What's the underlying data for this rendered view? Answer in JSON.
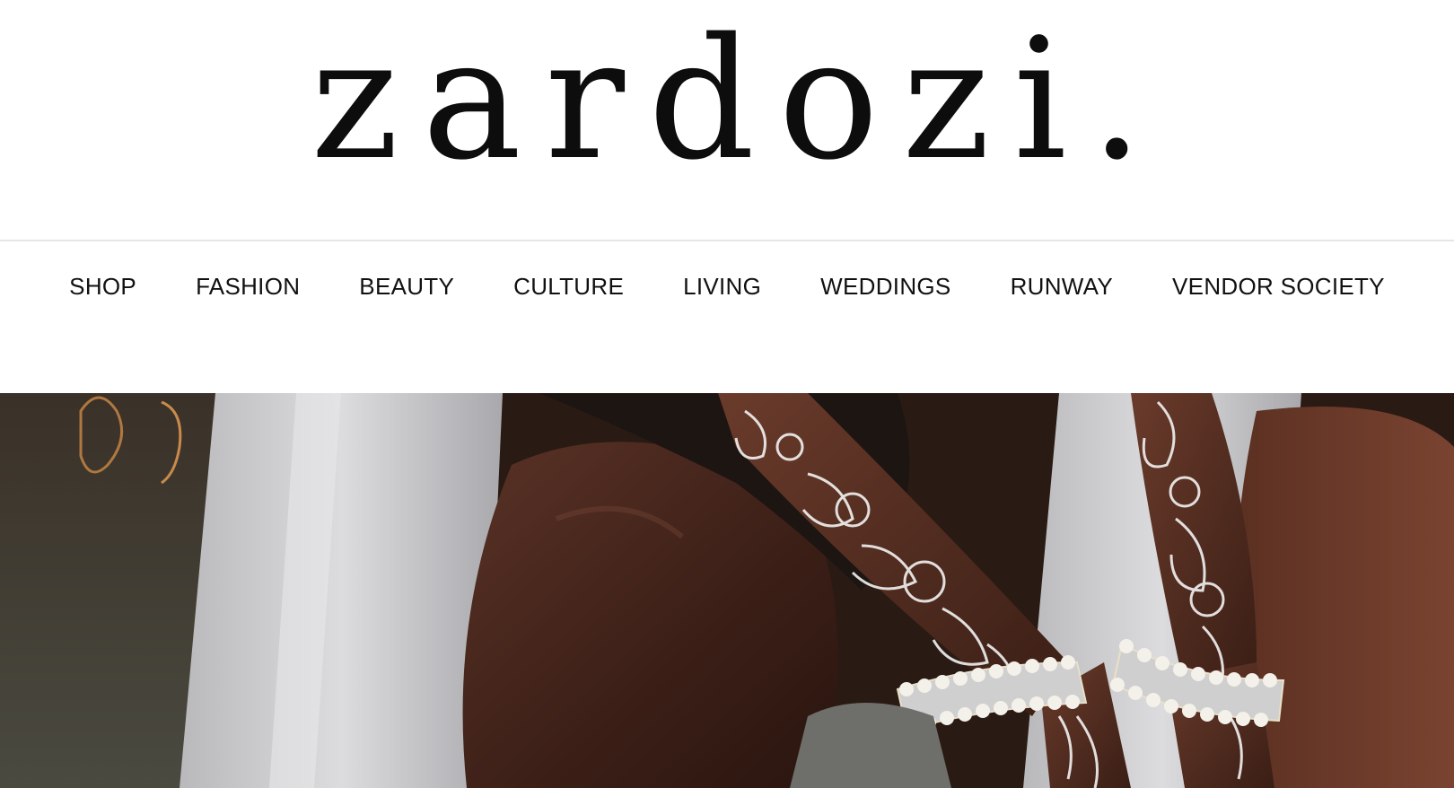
{
  "site": {
    "logo_text": "zardozi."
  },
  "nav": {
    "items": [
      {
        "label": "SHOP"
      },
      {
        "label": "FASHION"
      },
      {
        "label": "BEAUTY"
      },
      {
        "label": "CULTURE"
      },
      {
        "label": "LIVING"
      },
      {
        "label": "WEDDINGS"
      },
      {
        "label": "RUNWAY"
      },
      {
        "label": "VENDOR SOCIETY"
      }
    ]
  },
  "hero": {
    "image_subject": "hands-with-white-henna-and-pearl-bracelets",
    "colors": {
      "skin": "#3b1f17",
      "fabric": "#c9cbcf",
      "henna": "#f2f2f2",
      "background": "#2a1a14"
    }
  }
}
